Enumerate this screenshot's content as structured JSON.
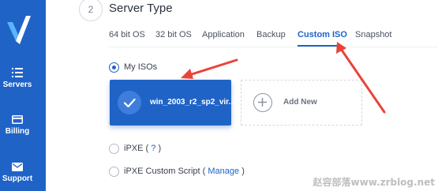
{
  "sidebar": {
    "items": [
      {
        "label": "Servers",
        "icon": "list-icon"
      },
      {
        "label": "Billing",
        "icon": "credit-card-icon"
      },
      {
        "label": "Support",
        "icon": "envelope-icon"
      }
    ]
  },
  "section": {
    "step": "2",
    "title": "Server Type"
  },
  "tabs": [
    {
      "label": "64 bit OS",
      "active": false
    },
    {
      "label": "32 bit OS",
      "active": false
    },
    {
      "label": "Application",
      "active": false
    },
    {
      "label": "Backup",
      "active": false
    },
    {
      "label": "Custom ISO",
      "active": true
    },
    {
      "label": "Snapshot",
      "active": false
    }
  ],
  "options": {
    "my_isos": {
      "label": "My ISOs",
      "selected": true
    },
    "ipxe": {
      "label": "iPXE (",
      "link": "?",
      "suffix": ")",
      "selected": false
    },
    "ipxe_custom": {
      "label": "iPXE Custom Script (",
      "link": "Manage",
      "suffix": ")",
      "selected": false
    }
  },
  "iso_card": {
    "name": "win_2003_r2_sp2_vir...",
    "selected": true
  },
  "add_card": {
    "label": "Add New"
  },
  "watermark": "赵容部落www.zrblog.net",
  "colors": {
    "brand": "#1f63c7",
    "annotation_arrow": "#e8443a"
  }
}
